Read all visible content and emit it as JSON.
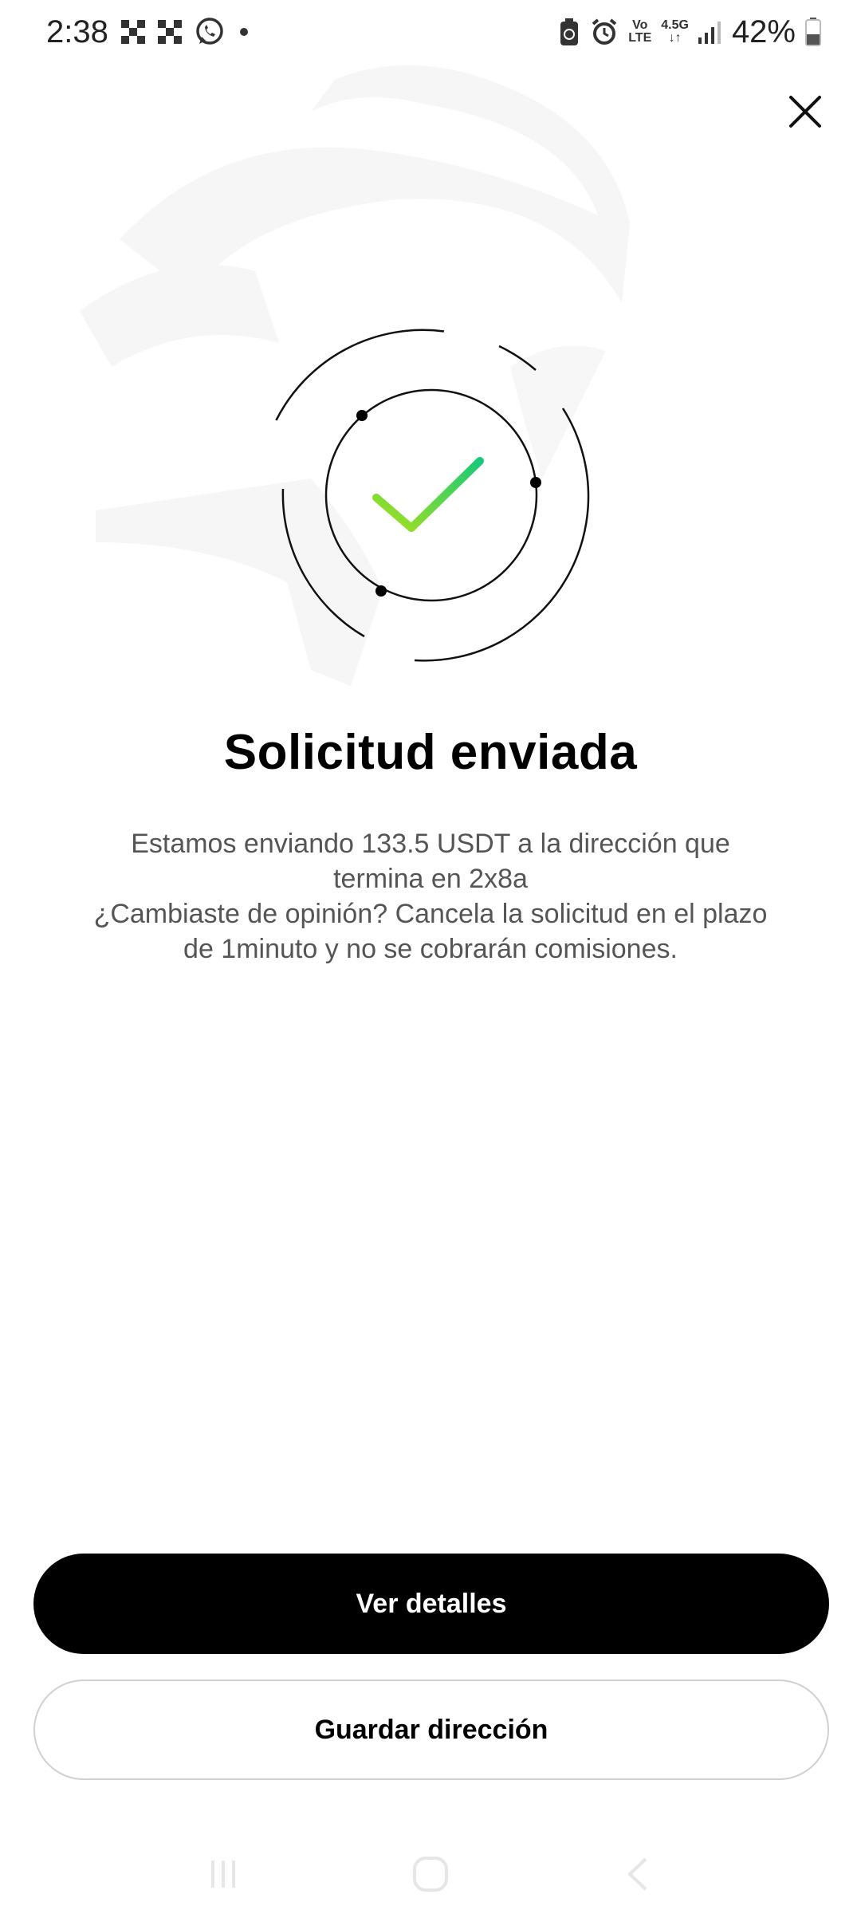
{
  "status_bar": {
    "time": "2:38",
    "notification_icons": [
      "qr-code-icon",
      "qr-code-icon",
      "whatsapp-icon",
      "dot-icon"
    ],
    "system_icons": [
      "battery-saver-icon",
      "alarm-icon",
      "volte-icon",
      "network-4-5g-icon",
      "signal-icon"
    ],
    "volte_label_top": "Vo",
    "volte_label_bottom": "LTE",
    "network_label": "4.5G",
    "battery_percent": "42%",
    "battery_level": 0.42
  },
  "dialog": {
    "title": "Solicitud enviada",
    "message_line1": "Estamos enviando 133.5 USDT a la dirección que termina en 2x8a",
    "message_line2": "¿Cambiaste de opinión? Cancela la solicitud en el plazo de 1minuto y no se cobrarán comisiones.",
    "accent_colors": [
      "#a5e21b",
      "#19c97a"
    ]
  },
  "actions": {
    "primary_label": "Ver detalles",
    "secondary_label": "Guardar dirección"
  },
  "nav": {
    "items": [
      "recent-apps-icon",
      "home-icon",
      "back-icon"
    ]
  }
}
